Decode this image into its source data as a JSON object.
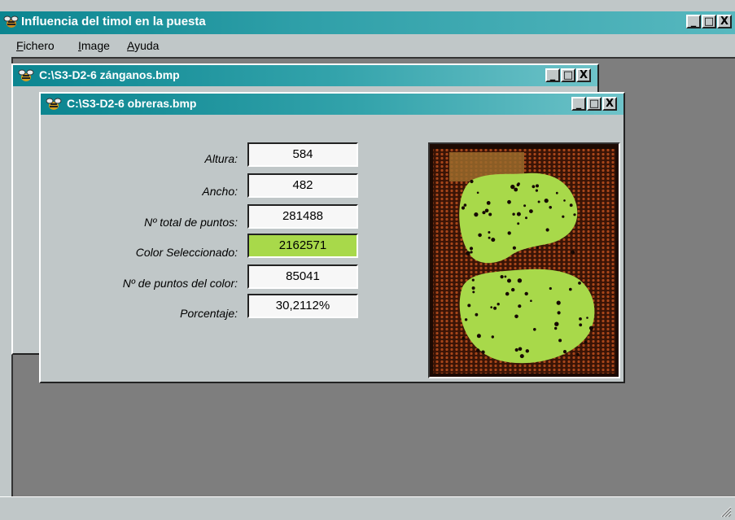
{
  "app": {
    "title": "Influencia del timol en la puesta",
    "window_buttons": {
      "minimize": "_",
      "maximize": "□",
      "close": "X"
    }
  },
  "menu": {
    "items": [
      {
        "label": "Fichero",
        "accel": "F",
        "rest": "ichero"
      },
      {
        "label": "Image",
        "accel": "I",
        "rest": "mage"
      },
      {
        "label": "Ayuda",
        "accel": "A",
        "rest": "yuda"
      }
    ]
  },
  "windows": {
    "back": {
      "title": "C:\\S3-D2-6 zánganos.bmp"
    },
    "front": {
      "title": "C:\\S3-D2-6 obreras.bmp",
      "fields": [
        {
          "label": "Altura:",
          "value": "584"
        },
        {
          "label": "Ancho:",
          "value": "482"
        },
        {
          "label": "Nº total de puntos:",
          "value": "281488"
        },
        {
          "label": "Color Seleccionado:",
          "value": "2162571"
        },
        {
          "label": "Nº de puntos del color:",
          "value": "85041"
        },
        {
          "label": "Porcentaje:",
          "value": "30,2112%"
        }
      ],
      "selected_color": "#a8d94a"
    }
  },
  "colors": {
    "titlebar": "#0b8590",
    "face": "#c0c7c8",
    "mdi_background": "#7e7e7e"
  },
  "icons": [
    "bee-icon",
    "minimize-icon",
    "maximize-icon",
    "close-icon",
    "size-grip-icon"
  ]
}
